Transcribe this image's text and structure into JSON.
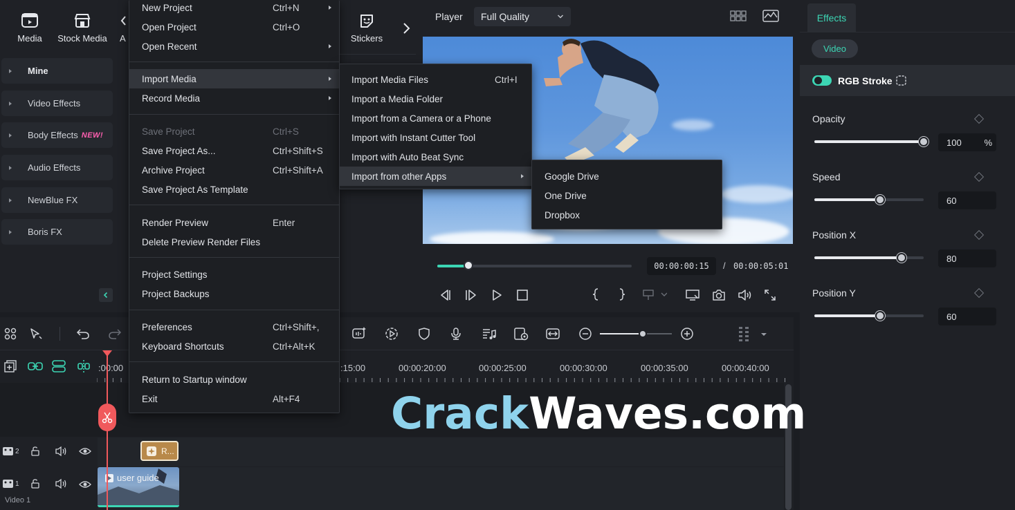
{
  "top_tabs": [
    {
      "label": "Media",
      "icon": "media-icon"
    },
    {
      "label": "Stock Media",
      "icon": "stock-media-icon"
    },
    {
      "label": "A",
      "icon": "audio-icon"
    },
    {
      "label": "Stickers",
      "icon": "stickers-icon"
    }
  ],
  "left_categories": [
    {
      "label": "Mine"
    },
    {
      "label": "Video Effects"
    },
    {
      "label": "Body Effects",
      "badge": "NEW!"
    },
    {
      "label": "Audio Effects"
    },
    {
      "label": "NewBlue FX"
    },
    {
      "label": "Boris FX"
    }
  ],
  "file_menu": {
    "items": [
      {
        "label": "New Project",
        "shortcut": "Ctrl+N",
        "submenu": true
      },
      {
        "label": "Open Project",
        "shortcut": "Ctrl+O"
      },
      {
        "label": "Open Recent",
        "shortcut": "",
        "submenu": true
      },
      {
        "label": "Import Media",
        "shortcut": "",
        "submenu": true,
        "highlighted": true
      },
      {
        "label": "Record Media",
        "shortcut": "",
        "submenu": true
      },
      {
        "label": "Save Project",
        "shortcut": "Ctrl+S",
        "disabled": true
      },
      {
        "label": "Save Project As...",
        "shortcut": "Ctrl+Shift+S"
      },
      {
        "label": "Archive Project",
        "shortcut": "Ctrl+Shift+A"
      },
      {
        "label": "Save Project As Template",
        "shortcut": ""
      },
      {
        "label": "Render Preview",
        "shortcut": "Enter"
      },
      {
        "label": "Delete Preview Render Files",
        "shortcut": ""
      },
      {
        "label": "Project Settings",
        "shortcut": ""
      },
      {
        "label": "Project Backups",
        "shortcut": ""
      },
      {
        "label": "Preferences",
        "shortcut": "Ctrl+Shift+,"
      },
      {
        "label": "Keyboard Shortcuts",
        "shortcut": "Ctrl+Alt+K"
      },
      {
        "label": "Return to Startup window",
        "shortcut": ""
      },
      {
        "label": "Exit",
        "shortcut": "Alt+F4"
      }
    ]
  },
  "import_menu": {
    "items": [
      {
        "label": "Import Media Files",
        "shortcut": "Ctrl+I"
      },
      {
        "label": "Import a Media Folder",
        "shortcut": ""
      },
      {
        "label": "Import from a Camera or a Phone",
        "shortcut": ""
      },
      {
        "label": "Import with Instant Cutter Tool",
        "shortcut": ""
      },
      {
        "label": "Import with Auto Beat Sync",
        "shortcut": ""
      },
      {
        "label": "Import from other Apps",
        "shortcut": "",
        "submenu": true,
        "highlighted": true
      }
    ]
  },
  "apps_menu": {
    "items": [
      {
        "label": "Google Drive"
      },
      {
        "label": "One Drive"
      },
      {
        "label": "Dropbox"
      }
    ]
  },
  "player": {
    "label": "Player",
    "quality": "Full Quality",
    "current_time": "00:00:00:15",
    "separator": "/",
    "total_time": "00:00:05:01",
    "progress": 0.16
  },
  "effects_panel": {
    "tab": "Effects",
    "subtab": "Video",
    "effect_name": "RGB Stroke",
    "enabled": true,
    "properties": [
      {
        "label": "Opacity",
        "value": "100",
        "unit": "%",
        "level": 1.0
      },
      {
        "label": "Speed",
        "value": "60",
        "unit": "",
        "level": 0.6
      },
      {
        "label": "Position X",
        "value": "80",
        "unit": "",
        "level": 0.8
      },
      {
        "label": "Position Y",
        "value": "60",
        "unit": "",
        "level": 0.6
      }
    ]
  },
  "timeline": {
    "ruler_labels": [
      ":00:00",
      ":15:00",
      "00:00:20:00",
      "00:00:25:00",
      "00:00:30:00",
      "00:00:35:00",
      "00:00:40:00"
    ],
    "track2_label": "2",
    "track1_label": "1",
    "track1_name": "Video 1",
    "effect_clip_label": "R...",
    "video_clip_label": "user guide",
    "zoom_level": 0.6
  },
  "watermark": {
    "part1": "Crack",
    "part2": "Waves.com"
  },
  "colors": {
    "accent": "#3cd6b4",
    "playhead": "#f0595c",
    "clip_effect": "#b8894a",
    "menu_bg": "#1d1f23"
  }
}
